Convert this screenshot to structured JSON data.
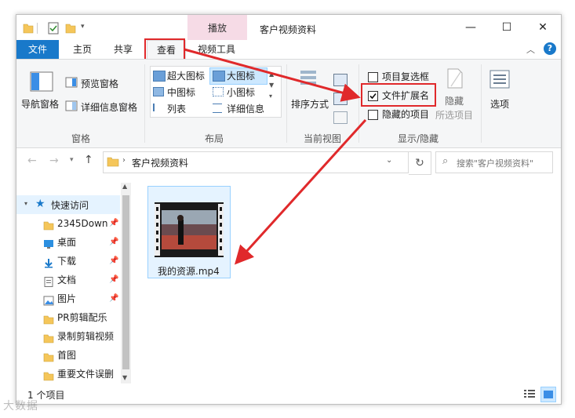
{
  "window": {
    "title": "客户视频资料",
    "play_tab": "播放",
    "controls": {
      "minimize": "—",
      "maximize": "☐",
      "close": "✕"
    }
  },
  "tabs": {
    "file": "文件",
    "home": "主页",
    "share": "共享",
    "view": "查看",
    "video_tools": "视频工具"
  },
  "ribbon": {
    "panes": {
      "nav_pane": "导航窗格",
      "preview_pane": "预览窗格",
      "details_pane": "详细信息窗格",
      "group": "窗格"
    },
    "layout": {
      "extra_large": "超大图标",
      "large": "大图标",
      "medium": "中图标",
      "small": "小图标",
      "list": "列表",
      "details": "详细信息",
      "group": "布局"
    },
    "current_view": {
      "sort_by": "排序方式",
      "group": "当前视图"
    },
    "show_hide": {
      "item_checkboxes": "项目复选框",
      "file_extensions": "文件扩展名",
      "hidden_items": "隐藏的项目",
      "hide_selected_line1": "隐藏",
      "hide_selected_line2": "所选项目",
      "group": "显示/隐藏",
      "file_extensions_checked": true
    },
    "options": "选项"
  },
  "nav": {
    "breadcrumb": "客户视频资料",
    "search_placeholder": "搜索\"客户视频资料\""
  },
  "sidebar": {
    "quick_access": "快速访问",
    "items": [
      {
        "label": "2345Down",
        "icon": "folder-icon",
        "pinned": true
      },
      {
        "label": "桌面",
        "icon": "desktop-icon",
        "pinned": true
      },
      {
        "label": "下载",
        "icon": "download-icon",
        "pinned": true
      },
      {
        "label": "文档",
        "icon": "document-icon",
        "pinned": true
      },
      {
        "label": "图片",
        "icon": "picture-icon",
        "pinned": true
      },
      {
        "label": "PR剪辑配乐",
        "icon": "folder-icon",
        "pinned": false
      },
      {
        "label": "录制剪辑视频",
        "icon": "folder-icon",
        "pinned": false
      },
      {
        "label": "首图",
        "icon": "folder-icon",
        "pinned": false
      },
      {
        "label": "重要文件误删",
        "icon": "folder-icon",
        "pinned": false
      }
    ]
  },
  "content": {
    "file_name": "我的资源.mp4"
  },
  "status": {
    "item_count": "1 个项目"
  },
  "watermark": "大数据",
  "colors": {
    "accent": "#1979ca",
    "annotation_red": "#e0292b",
    "play_tab": "#f6dbe6"
  }
}
